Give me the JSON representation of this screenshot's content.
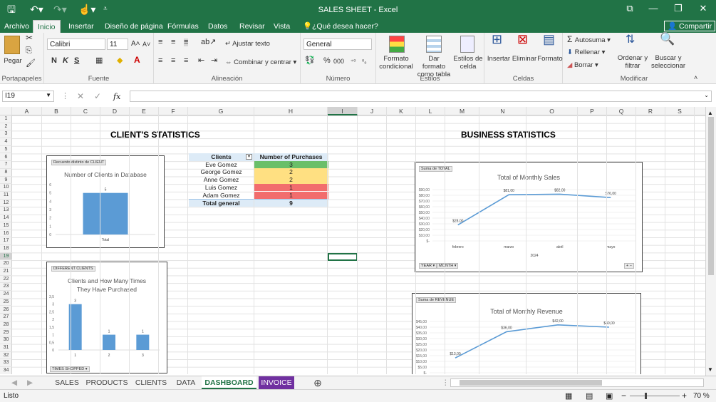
{
  "app": {
    "title": "SALES SHEET - Excel",
    "share": "Compartir"
  },
  "ribbon_tabs": [
    "Archivo",
    "Inicio",
    "Insertar",
    "Diseño de página",
    "Fórmulas",
    "Datos",
    "Revisar",
    "Vista"
  ],
  "tell_me": "¿Qué desea hacer?",
  "ribbon": {
    "clipboard": {
      "paste": "Pegar",
      "label": "Portapapeles"
    },
    "font": {
      "name": "Calibri",
      "size": "11",
      "label": "Fuente",
      "bold": "N",
      "italic": "K",
      "underline": "S"
    },
    "alignment": {
      "wrap": "Ajustar texto",
      "merge": "Combinar y centrar",
      "label": "Alineación"
    },
    "number": {
      "format": "General",
      "label": "Número",
      "percent": "%",
      "thousands": "000"
    },
    "styles": {
      "cond": "Formato condicional",
      "table": "Dar formato como tabla",
      "cell": "Estilos de celda",
      "label": "Estilos"
    },
    "cells": {
      "insert": "Insertar",
      "delete": "Eliminar",
      "format": "Formato",
      "label": "Celdas"
    },
    "editing": {
      "autosum": "Autosuma",
      "fill": "Rellenar",
      "clear": "Borrar",
      "sort": "Ordenar y filtrar",
      "find": "Buscar y seleccionar",
      "label": "Modificar"
    }
  },
  "formula_bar": {
    "namebox": "I19",
    "fx": "fx",
    "value": ""
  },
  "columns": [
    "A",
    "B",
    "C",
    "D",
    "E",
    "F",
    "G",
    "H",
    "I",
    "J",
    "K",
    "L",
    "M",
    "N",
    "O",
    "P",
    "Q",
    "R",
    "S"
  ],
  "selected_col": "I",
  "selected_row": "19",
  "rows": [
    "1",
    "2",
    "3",
    "4",
    "5",
    "6",
    "7",
    "8",
    "9",
    "10",
    "11",
    "12",
    "13",
    "14",
    "15",
    "16",
    "17",
    "18",
    "19",
    "20",
    "21",
    "22",
    "23",
    "24",
    "25",
    "26",
    "27",
    "28",
    "29",
    "30",
    "31",
    "32",
    "33",
    "34"
  ],
  "headings": {
    "clients": "CLIENT'S STATISTICS",
    "business": "BUSINESS STATISTICS"
  },
  "pivot": {
    "header": [
      "Clients",
      "Number of Purchases"
    ],
    "rows": [
      {
        "name": "Eve Gomez",
        "value": "3",
        "color": "#6abf69"
      },
      {
        "name": "George Gomez",
        "value": "2",
        "color": "#ffe082"
      },
      {
        "name": "Anne Gomez",
        "value": "2",
        "color": "#ffe082"
      },
      {
        "name": "Luis Gomez",
        "value": "1",
        "color": "#f26d6d"
      },
      {
        "name": "Adam Gomez",
        "value": "1",
        "color": "#f26d6d"
      }
    ],
    "total_label": "Total general",
    "total_value": "9"
  },
  "chart_data": [
    {
      "type": "bar",
      "tag": "Recuento distinto de CLIENT",
      "title": "Number of Clients in Database",
      "categories": [
        "Total"
      ],
      "values": [
        5
      ],
      "ylim": [
        0,
        6
      ],
      "yticks": [
        "0",
        "1",
        "2",
        "3",
        "4",
        "5",
        "6"
      ],
      "color": "#5b9bd5"
    },
    {
      "type": "bar",
      "tag": "DIFFERENT CLIENTS",
      "title": "Clients and How Many Times They Have Purchased",
      "categories": [
        "1",
        "2",
        "3"
      ],
      "values": [
        3,
        1,
        1
      ],
      "ylim": [
        0,
        3.5
      ],
      "yticks": [
        "0",
        "0,5",
        "1",
        "1,5",
        "2",
        "2,5",
        "3",
        "3,5"
      ],
      "footer_button": "TIMES SHOPPED",
      "color": "#5b9bd5"
    },
    {
      "type": "line",
      "tag": "Suma de TOTAL",
      "title": "Total of Monthly Sales",
      "categories": [
        "febrero",
        "marzo",
        "abril",
        "mayo"
      ],
      "values": [
        28,
        81,
        82,
        76
      ],
      "data_labels": [
        "$28,00",
        "$81,00",
        "$82,00",
        "$76,00"
      ],
      "ylim": [
        0,
        90
      ],
      "yticks": [
        "$-",
        "$10,00",
        "$20,00",
        "$30,00",
        "$40,00",
        "$50,00",
        "$60,00",
        "$70,00",
        "$80,00",
        "$90,00"
      ],
      "year_label": "2024",
      "buttons": [
        "YEAR",
        "MONTH"
      ],
      "color": "#5b9bd5"
    },
    {
      "type": "line",
      "tag": "Suma de REVENUE",
      "title": "Total of Monthly Revenue",
      "categories": [
        "febrero",
        "marzo",
        "abril",
        "mayo"
      ],
      "values": [
        13,
        36,
        42,
        40
      ],
      "data_labels": [
        "$13,00",
        "$36,00",
        "$42,00",
        "$40,00"
      ],
      "ylim": [
        0,
        45
      ],
      "yticks": [
        "$-",
        "$5,00",
        "$10,00",
        "$15,00",
        "$20,00",
        "$25,00",
        "$30,00",
        "$35,00",
        "$40,00",
        "$45,00"
      ],
      "color": "#5b9bd5"
    }
  ],
  "sheet_tabs": [
    "SALES",
    "PRODUCTS",
    "CLIENTS",
    "DATA",
    "DASHBOARD",
    "INVOICE"
  ],
  "active_sheet": "DASHBOARD",
  "status": {
    "ready": "Listo",
    "zoom": "70 %"
  },
  "colors": {
    "accent": "#217346",
    "invoice_tab": "#7030a0",
    "pivot_header": "#ddebf7"
  }
}
